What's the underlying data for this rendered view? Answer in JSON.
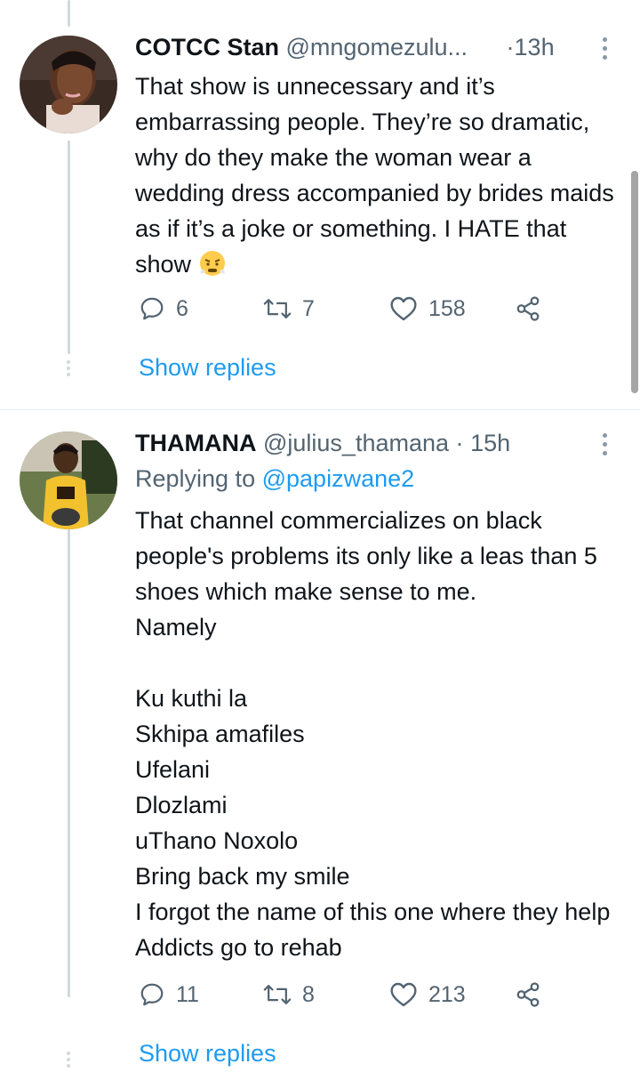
{
  "tweets": [
    {
      "name": "COTCC Stan",
      "handle": "@mngomezulu...",
      "time": "13h",
      "text": "That show is unnecessary and it’s embarrassing people. They’re so dramatic, why do they make the woman wear a wedding dress accompanied by brides maids as if it’s a joke or something. I HATE that show",
      "emoji": "face-with-steam-from-nose",
      "replies": "6",
      "retweets": "7",
      "likes": "158",
      "show_replies": "Show replies"
    },
    {
      "name": "THAMANA",
      "handle": "@julius_thamana",
      "time": "15h",
      "replying_label": "Replying to",
      "replying_to": "@papizwane2",
      "text": "That channel commercializes on black people's problems its only like a leas than 5 shoes which make sense to me.\nNamely\n\nKu kuthi la\nSkhipa amafiles\nUfelani\nDlozlami\nuThano Noxolo\nBring back my smile\nI forgot the name of this one where they help Addicts go to rehab",
      "replies": "11",
      "retweets": "8",
      "likes": "213",
      "show_replies": "Show replies"
    }
  ],
  "icons": {
    "reply": "reply-icon",
    "retweet": "retweet-icon",
    "like": "heart-icon",
    "share": "share-icon",
    "more": "more-icon"
  },
  "colors": {
    "link": "#1d9bf0",
    "secondary_text": "#536471",
    "thread_line": "#cfd9de"
  }
}
